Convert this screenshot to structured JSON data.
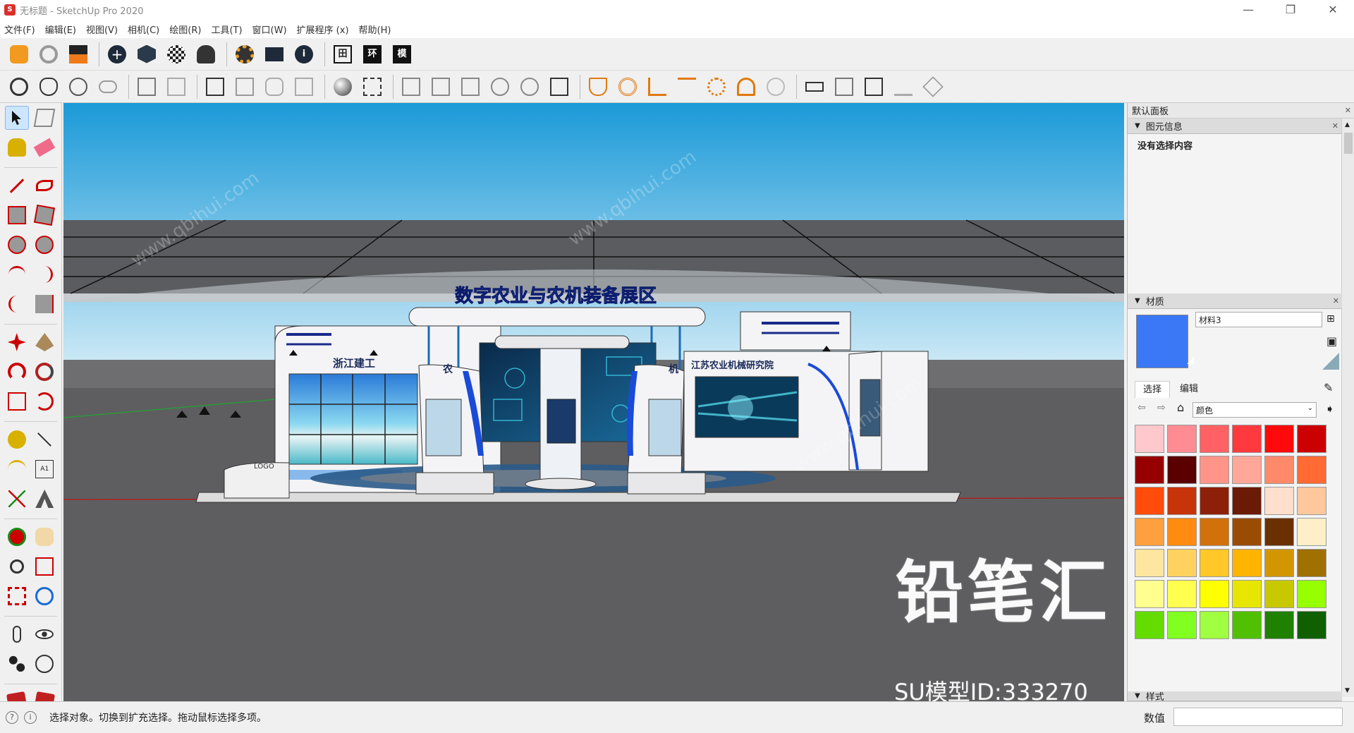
{
  "window": {
    "title": "无标题 - SketchUp Pro 2020",
    "minimize": "—",
    "maximize": "❐",
    "close": "✕"
  },
  "menu": [
    "文件(F)",
    "编辑(E)",
    "视图(V)",
    "相机(C)",
    "绘图(R)",
    "工具(T)",
    "窗口(W)",
    "扩展程序 (x)",
    "帮助(H)"
  ],
  "toolbar1_labels": {
    "grid": "田",
    "env": "环",
    "model": "模"
  },
  "scene": {
    "banner": "数字农业与农机装备展区",
    "left_sign": "浙江建工",
    "right_sign": "江苏农业机械研究院",
    "logo": "LOGO",
    "char_a": "农",
    "char_b": "机"
  },
  "panel": {
    "title": "默认面板",
    "entity_info": {
      "header": "图元信息",
      "content": "没有选择内容"
    },
    "materials": {
      "header": "材质",
      "name": "材料3",
      "tab_select": "选择",
      "tab_edit": "编辑",
      "category": "颜色",
      "current_color": "#3b78f5",
      "swatches": [
        "#ffc8cc",
        "#ff8c92",
        "#ff6165",
        "#ff3a3e",
        "#ff0a0a",
        "#cc0000",
        "#960000",
        "#5a0000",
        "#ff9488",
        "#ffa89a",
        "#ff8a6a",
        "#ff6a35",
        "#ff4c0a",
        "#c8340a",
        "#8c2008",
        "#6a1a05",
        "#ffe0cc",
        "#ffc89c",
        "#ffa040",
        "#ff8c10",
        "#d2700a",
        "#9a4c05",
        "#6a3002",
        "#ffefc8",
        "#ffe6a0",
        "#ffd260",
        "#ffc828",
        "#ffb400",
        "#d29600",
        "#a07000",
        "#ffff90",
        "#ffff50",
        "#ffff00",
        "#e6e600",
        "#c8c800",
        "#96ff00",
        "#64dc00",
        "#80ff20",
        "#a0ff40",
        "#50c000",
        "#208000",
        "#106000"
      ]
    },
    "styles_header": "样式"
  },
  "status": {
    "text": "选择对象。切换到扩充选择。拖动鼠标选择多项。",
    "measure_label": "数值"
  },
  "watermark": {
    "big": "铅笔汇",
    "id": "SU模型ID:333270",
    "diag": "www.qbihui.com"
  }
}
